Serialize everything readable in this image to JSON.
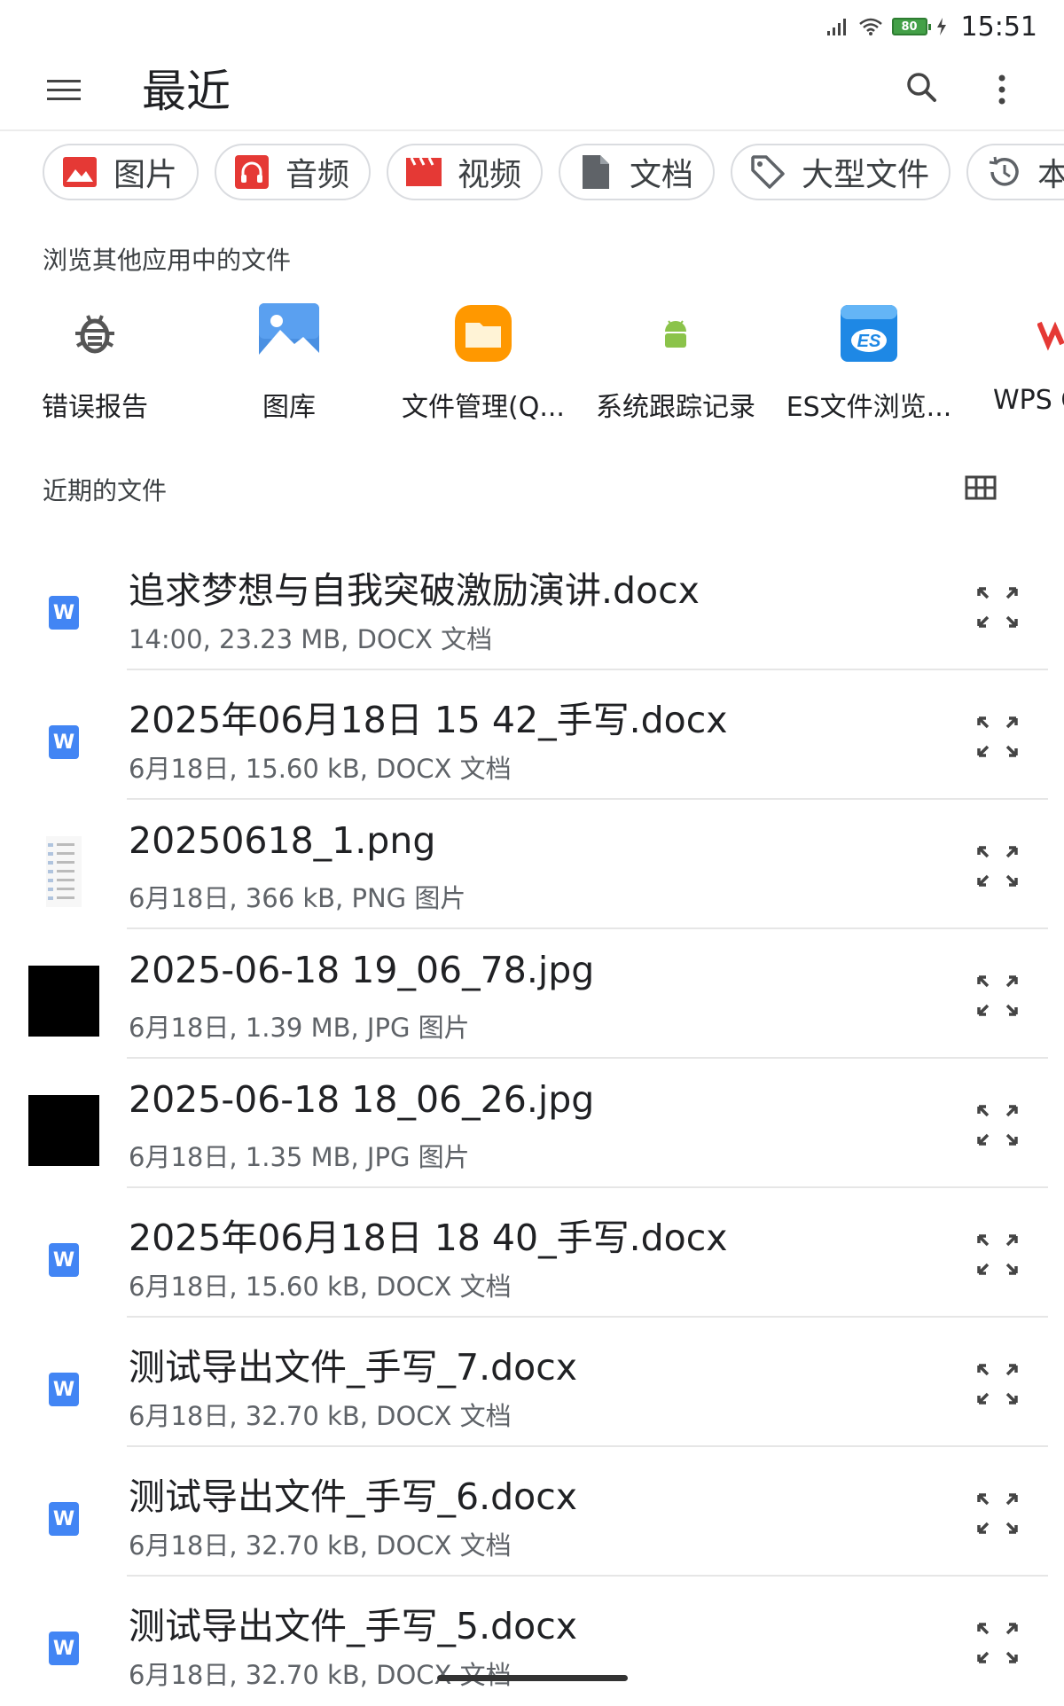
{
  "status_bar": {
    "time": "15:51",
    "battery_level": "80"
  },
  "header": {
    "title": "最近"
  },
  "chips": [
    {
      "label": "图片",
      "icon": "image-icon",
      "color": "#e53935"
    },
    {
      "label": "音频",
      "icon": "headphones-icon",
      "color": "#e53935"
    },
    {
      "label": "视频",
      "icon": "movie-icon",
      "color": "#e53935"
    },
    {
      "label": "文档",
      "icon": "document-icon",
      "color": "#5f6368"
    },
    {
      "label": "大型文件",
      "icon": "tag-icon",
      "color": "#5f6368"
    },
    {
      "label": "本",
      "icon": "history-icon",
      "color": "#5f6368"
    }
  ],
  "other_apps": {
    "title": "浏览其他应用中的文件",
    "items": [
      {
        "label": "错误报告",
        "icon": "bug-icon"
      },
      {
        "label": "图库",
        "icon": "gallery-icon"
      },
      {
        "label": "文件管理(Q...",
        "icon": "file-manager-icon"
      },
      {
        "label": "系统跟踪记录",
        "icon": "android-icon"
      },
      {
        "label": "ES文件浏览...",
        "icon": "es-file-explorer-icon"
      },
      {
        "label": "WPS O",
        "icon": "wps-icon"
      }
    ]
  },
  "recent": {
    "title": "近期的文件",
    "files": [
      {
        "name": "追求梦想与自我突破激励演讲.docx",
        "meta": "14:00, 23.23 MB, DOCX 文档",
        "thumb": "word"
      },
      {
        "name": "2025年06月18日 15 42_手写.docx",
        "meta": "6月18日, 15.60 kB, DOCX 文档",
        "thumb": "word"
      },
      {
        "name": "20250618_1.png",
        "meta": "6月18日, 366 kB, PNG 图片",
        "thumb": "png"
      },
      {
        "name": "2025-06-18 19_06_78.jpg",
        "meta": "6月18日, 1.39 MB, JPG 图片",
        "thumb": "black"
      },
      {
        "name": "2025-06-18 18_06_26.jpg",
        "meta": "6月18日, 1.35 MB, JPG 图片",
        "thumb": "black"
      },
      {
        "name": "2025年06月18日 18 40_手写.docx",
        "meta": "6月18日, 15.60 kB, DOCX 文档",
        "thumb": "word"
      },
      {
        "name": "测试导出文件_手写_7.docx",
        "meta": "6月18日, 32.70 kB, DOCX 文档",
        "thumb": "word"
      },
      {
        "name": "测试导出文件_手写_6.docx",
        "meta": "6月18日, 32.70 kB, DOCX 文档",
        "thumb": "word"
      },
      {
        "name": "测试导出文件_手写_5.docx",
        "meta": "6月18日, 32.70 kB, DOCX 文档",
        "thumb": "word"
      }
    ],
    "word_badge": "W"
  }
}
